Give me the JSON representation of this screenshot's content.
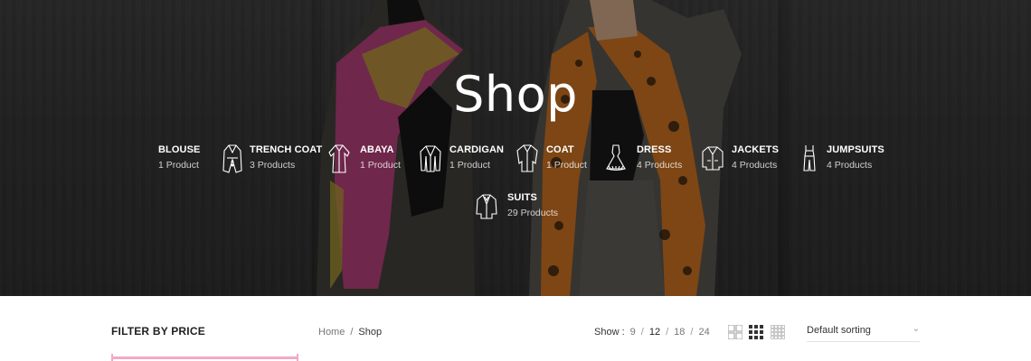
{
  "hero": {
    "title": "Shop",
    "categories": [
      {
        "name": "BLOUSE",
        "count": "1 Product",
        "icon": "blouse-icon"
      },
      {
        "name": "TRENCH COAT",
        "count": "3 Products",
        "icon": "trench-coat-icon"
      },
      {
        "name": "ABAYA",
        "count": "1 Product",
        "icon": "abaya-icon"
      },
      {
        "name": "CARDIGAN",
        "count": "1 Product",
        "icon": "cardigan-icon"
      },
      {
        "name": "COAT",
        "count": "1 Product",
        "icon": "coat-icon"
      },
      {
        "name": "DRESS",
        "count": "4 Products",
        "icon": "dress-icon"
      },
      {
        "name": "JACKETS",
        "count": "4 Products",
        "icon": "jacket-icon"
      },
      {
        "name": "JUMPSUITS",
        "count": "4 Products",
        "icon": "jumpsuit-icon"
      },
      {
        "name": "SUITS",
        "count": "29 Products",
        "icon": "suit-icon"
      }
    ]
  },
  "sidebar": {
    "filter_title": "FILTER BY PRICE"
  },
  "breadcrumb": {
    "home": "Home",
    "separator": "/",
    "current": "Shop"
  },
  "toolbar": {
    "show_label": "Show :",
    "per_page": [
      "9",
      "12",
      "18",
      "24"
    ],
    "per_page_active": "12",
    "per_sep": "/",
    "sorting": "Default sorting",
    "views": [
      "grid-2-icon",
      "grid-3-icon",
      "grid-4-icon"
    ],
    "active_view": "grid-3-icon"
  },
  "colors": {
    "accent": "#f2a9c9",
    "hero_text": "#ffffff"
  }
}
